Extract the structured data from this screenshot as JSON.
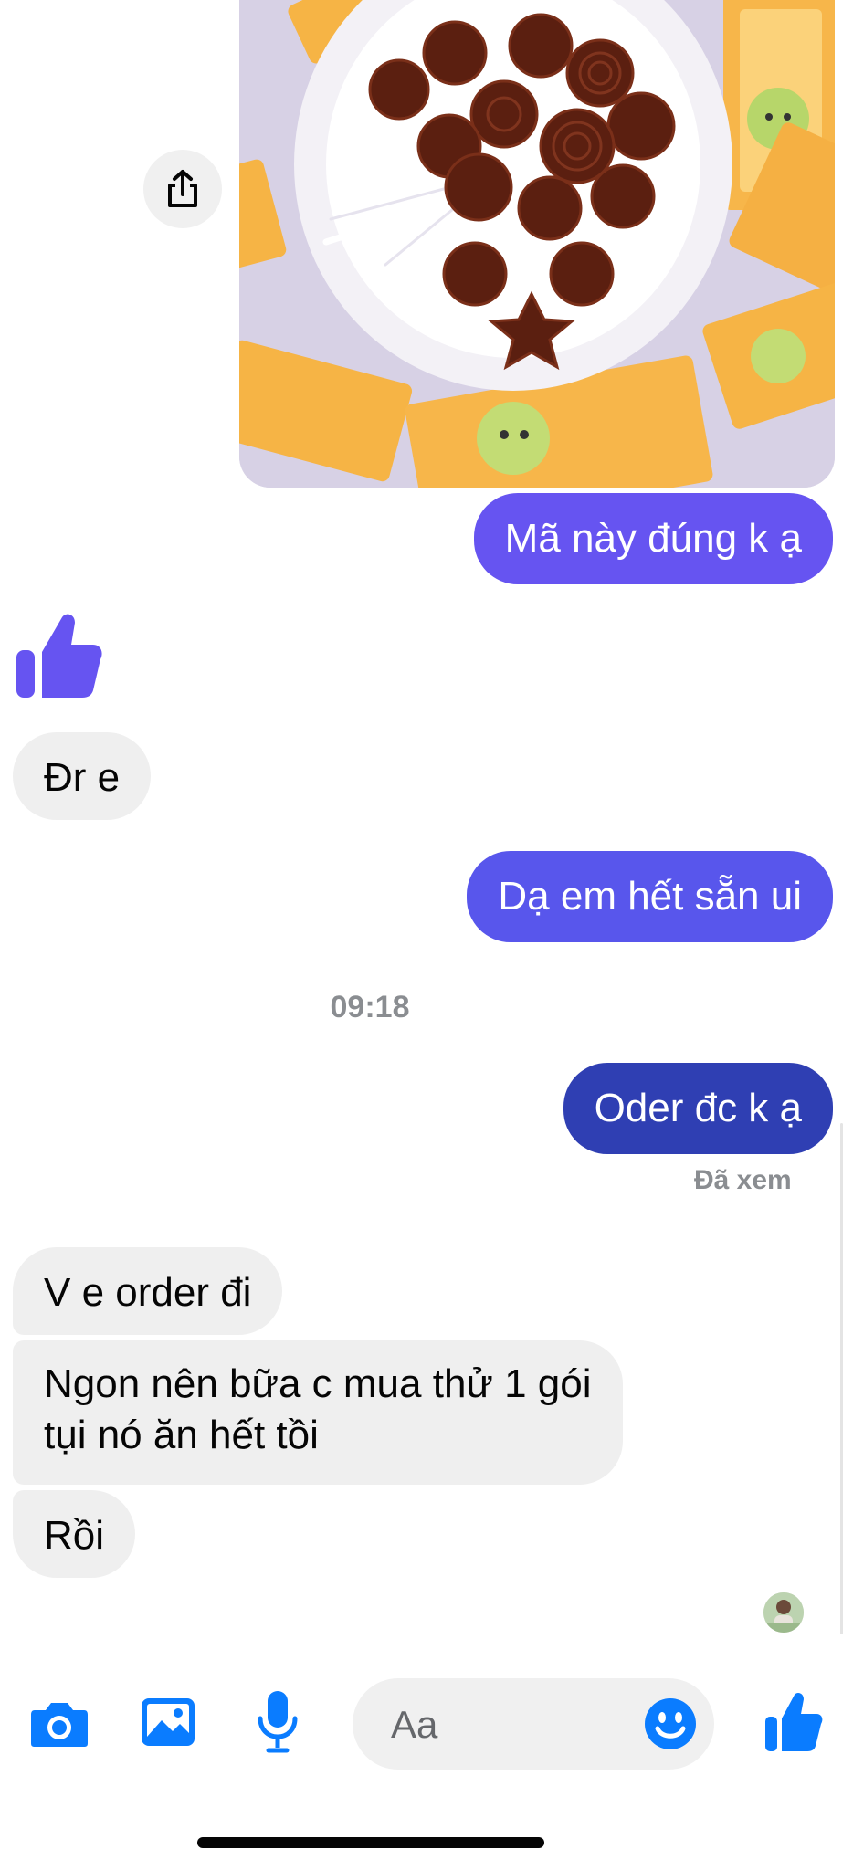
{
  "messages": {
    "m1": "Mã này đúng k ạ",
    "m2": "Đr e",
    "m3": "Dạ em hết sẵn ui",
    "m4": "Oder đc k ạ",
    "m5": "V e order đi",
    "m6_line1": "Ngon nên bữa c mua thử 1 gói",
    "m6_line2": "tụi nó ăn hết tồi",
    "m7": "Rồi"
  },
  "timestamp": "09:18",
  "seen_status": "Đã xem",
  "composer": {
    "placeholder": "Aa"
  },
  "colors": {
    "outgoing_purple": "#6654f1",
    "outgoing_blue": "#2f3fb3",
    "incoming_gray": "#efefef",
    "messenger_blue": "#0a7cff"
  },
  "icons": {
    "share": "share-icon",
    "thumbs_up": "thumbs-up-icon",
    "camera": "camera-icon",
    "gallery": "image-icon",
    "mic": "microphone-icon",
    "emoji": "emoji-icon",
    "like": "like-icon"
  }
}
